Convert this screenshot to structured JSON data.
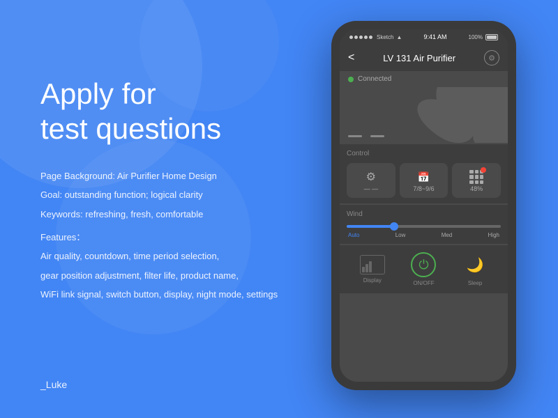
{
  "background": {
    "color": "#4285f4"
  },
  "left": {
    "title_line1": "Apply for",
    "title_line2": "test questions",
    "desc_line1": "Page Background: Air Purifier Home Design",
    "desc_line2": "Goal: outstanding function; logical clarity",
    "desc_line3": "Keywords: refreshing, fresh, comfortable",
    "features_label": "Features：",
    "features_line1": "Air quality, countdown, time period selection,",
    "features_line2": "gear position adjustment, filter life, product name,",
    "features_line3": "WiFi link signal, switch button, display, night mode, settings",
    "author": "_Luke"
  },
  "phone": {
    "status": {
      "carrier": "Sketch",
      "time": "9:41 AM",
      "battery": "100%"
    },
    "header": {
      "title": "LV 131 Air Purifier",
      "back": "<",
      "settings": "⚙"
    },
    "connected": "Connected",
    "control": {
      "label": "Control",
      "card1_value": "— —",
      "card2_value": "7/8~9/6",
      "card3_value": "48%"
    },
    "wind": {
      "label": "Wind",
      "labels": [
        "Auto",
        "Low",
        "Med",
        "High"
      ]
    },
    "bottom": {
      "btn1": "Display",
      "btn2": "ON/OFF",
      "btn3": "Sleep"
    }
  }
}
